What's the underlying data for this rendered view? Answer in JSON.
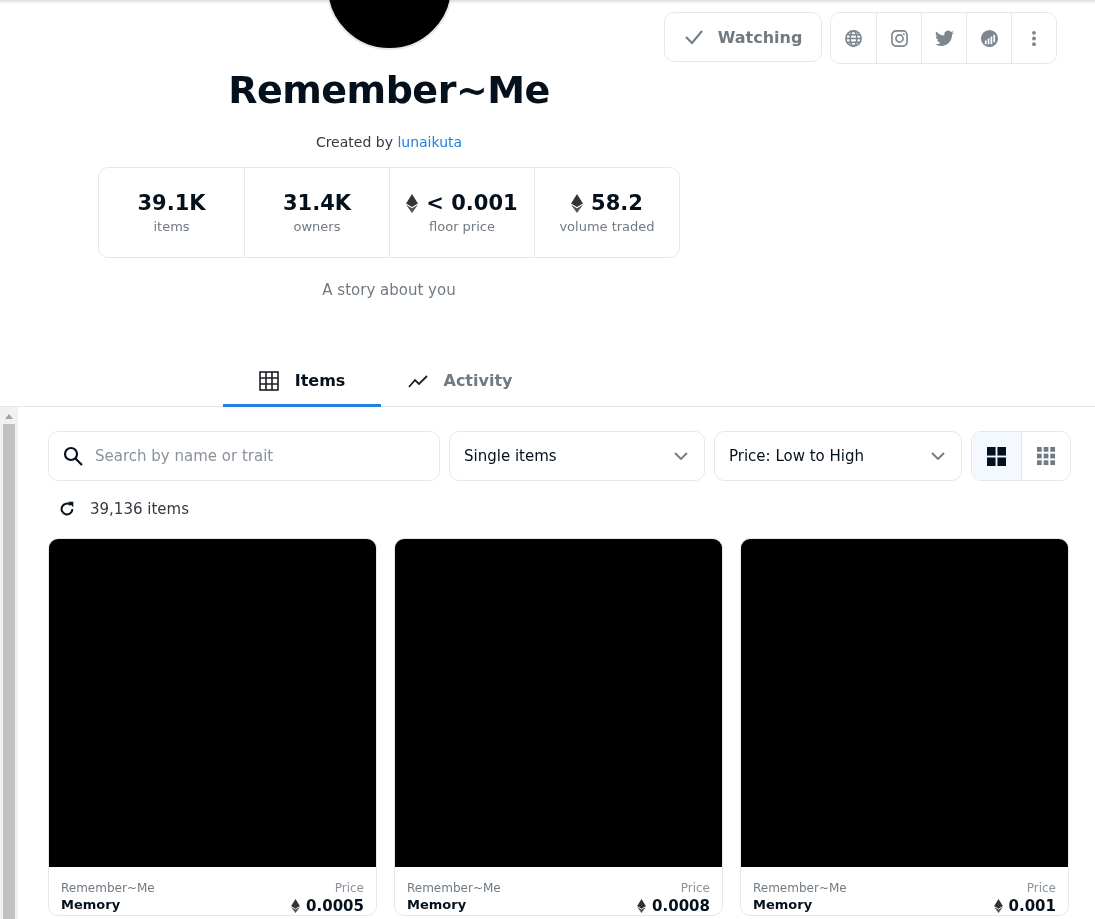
{
  "collection": {
    "title": "Remember~Me",
    "created_by_label": "Created by",
    "creator": "lunaikuta",
    "description": "A story about you"
  },
  "watch_button": {
    "label": "Watching",
    "checked": true
  },
  "social_buttons": [
    {
      "kind": "website"
    },
    {
      "kind": "instagram"
    },
    {
      "kind": "twitter"
    },
    {
      "kind": "stats"
    },
    {
      "kind": "more"
    }
  ],
  "stats": [
    {
      "value": "39.1K",
      "label": "items",
      "eth": false
    },
    {
      "value": "31.4K",
      "label": "owners",
      "eth": false
    },
    {
      "value": "< 0.001",
      "label": "floor price",
      "eth": true
    },
    {
      "value": "58.2",
      "label": "volume traded",
      "eth": true
    }
  ],
  "tabs": [
    {
      "label": "Items",
      "kind": "grid",
      "selected": true
    },
    {
      "label": "Activity",
      "kind": "chart",
      "selected": false
    }
  ],
  "search": {
    "placeholder": "Search by name or trait"
  },
  "filters": [
    {
      "value": "Single items"
    },
    {
      "value": "Price: Low to High"
    }
  ],
  "view_toggle": [
    {
      "kind": "large",
      "selected": true
    },
    {
      "kind": "small",
      "selected": false
    }
  ],
  "item_count": "39,136 items",
  "cards": [
    {
      "collection": "Remember~Me",
      "price_label": "Price",
      "name": "Memory",
      "price": "0.0005"
    },
    {
      "collection": "Remember~Me",
      "price_label": "Price",
      "name": "Memory",
      "price": "0.0008"
    },
    {
      "collection": "Remember~Me",
      "price_label": "Price",
      "name": "Memory",
      "price": "0.001"
    }
  ]
}
